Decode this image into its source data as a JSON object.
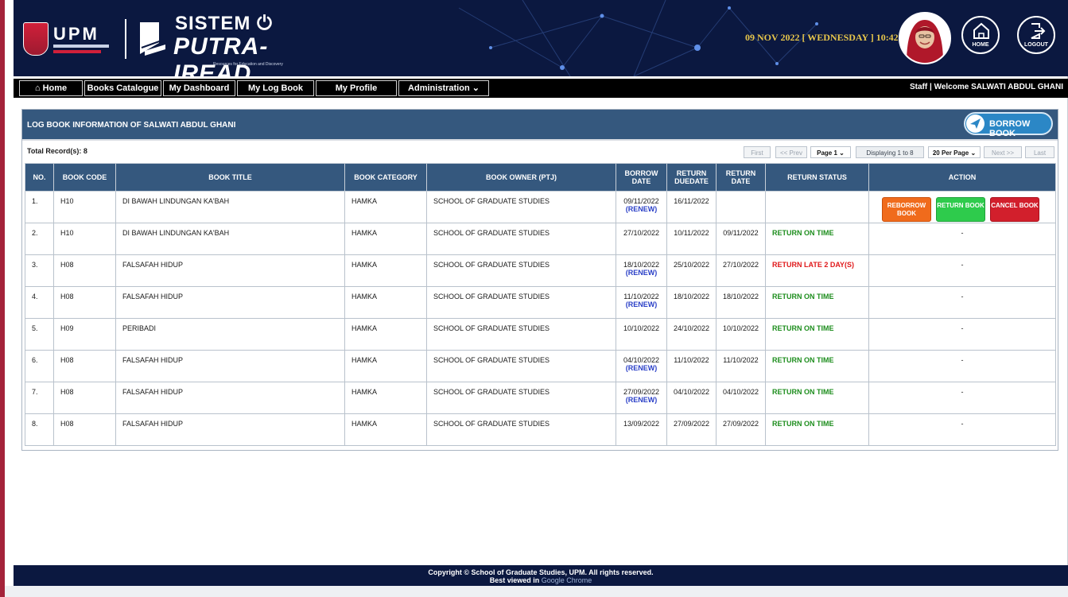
{
  "header": {
    "datetime": "09 NOV 2022 [ WEDNESDAY ] 10:42 PM",
    "home_label": "HOME",
    "logout_label": "LOGOUT"
  },
  "nav": {
    "items": [
      "Home",
      "Books Catalogue",
      "My Dashboard",
      "My Log Book",
      "My Profile",
      "Administration"
    ],
    "welcome": "Staff | Welcome SALWATI ABDUL GHANI"
  },
  "panel": {
    "title": "LOG BOOK INFORMATION OF SALWATI ABDUL GHANI",
    "borrow_button": "BORROW BOOK",
    "total": "Total Record(s): 8",
    "pager": {
      "first": "First",
      "prev": "<< Prev",
      "page": "Page 1",
      "display": "Displaying 1 to 8",
      "per_page": "20 Per Page",
      "next": "Next >>",
      "last": "Last"
    }
  },
  "table": {
    "headers": [
      "NO.",
      "BOOK CODE",
      "BOOK TITLE",
      "BOOK CATEGORY",
      "BOOK OWNER (PTJ)",
      "BORROW DATE",
      "RETURN DUEDATE",
      "RETURN DATE",
      "RETURN STATUS",
      "ACTION"
    ],
    "rows": [
      {
        "no": "1.",
        "code": "H10",
        "title": "DI BAWAH LINDUNGAN KA'BAH",
        "category": "HAMKA",
        "owner": "SCHOOL OF GRADUATE STUDIES",
        "borrow": "09/11/2022",
        "renew": "(RENEW)",
        "due": "16/11/2022",
        "returned": "",
        "status": "",
        "status_type": "none",
        "actions": true,
        "action_text": ""
      },
      {
        "no": "2.",
        "code": "H10",
        "title": "DI BAWAH LINDUNGAN KA'BAH",
        "category": "HAMKA",
        "owner": "SCHOOL OF GRADUATE STUDIES",
        "borrow": "27/10/2022",
        "renew": "",
        "due": "10/11/2022",
        "returned": "09/11/2022",
        "status": "RETURN ON TIME",
        "status_type": "ok",
        "actions": false,
        "action_text": "-"
      },
      {
        "no": "3.",
        "code": "H08",
        "title": "FALSAFAH HIDUP",
        "category": "HAMKA",
        "owner": "SCHOOL OF GRADUATE STUDIES",
        "borrow": "18/10/2022",
        "renew": "(RENEW)",
        "due": "25/10/2022",
        "returned": "27/10/2022",
        "status": "RETURN LATE 2 DAY(S)",
        "status_type": "late",
        "actions": false,
        "action_text": "-"
      },
      {
        "no": "4.",
        "code": "H08",
        "title": "FALSAFAH HIDUP",
        "category": "HAMKA",
        "owner": "SCHOOL OF GRADUATE STUDIES",
        "borrow": "11/10/2022",
        "renew": "(RENEW)",
        "due": "18/10/2022",
        "returned": "18/10/2022",
        "status": "RETURN ON TIME",
        "status_type": "ok",
        "actions": false,
        "action_text": "-"
      },
      {
        "no": "5.",
        "code": "H09",
        "title": "PERIBADI",
        "category": "HAMKA",
        "owner": "SCHOOL OF GRADUATE STUDIES",
        "borrow": "10/10/2022",
        "renew": "",
        "due": "24/10/2022",
        "returned": "10/10/2022",
        "status": "RETURN ON TIME",
        "status_type": "ok",
        "actions": false,
        "action_text": "-"
      },
      {
        "no": "6.",
        "code": "H08",
        "title": "FALSAFAH HIDUP",
        "category": "HAMKA",
        "owner": "SCHOOL OF GRADUATE STUDIES",
        "borrow": "04/10/2022",
        "renew": "(RENEW)",
        "due": "11/10/2022",
        "returned": "11/10/2022",
        "status": "RETURN ON TIME",
        "status_type": "ok",
        "actions": false,
        "action_text": "-"
      },
      {
        "no": "7.",
        "code": "H08",
        "title": "FALSAFAH HIDUP",
        "category": "HAMKA",
        "owner": "SCHOOL OF GRADUATE STUDIES",
        "borrow": "27/09/2022",
        "renew": "(RENEW)",
        "due": "04/10/2022",
        "returned": "04/10/2022",
        "status": "RETURN ON TIME",
        "status_type": "ok",
        "actions": false,
        "action_text": "-"
      },
      {
        "no": "8.",
        "code": "H08",
        "title": "FALSAFAH HIDUP",
        "category": "HAMKA",
        "owner": "SCHOOL OF GRADUATE STUDIES",
        "borrow": "13/09/2022",
        "renew": "",
        "due": "27/09/2022",
        "returned": "27/09/2022",
        "status": "RETURN ON TIME",
        "status_type": "ok",
        "actions": false,
        "action_text": "-"
      }
    ],
    "action_labels": {
      "reborrow": "REBORROW BOOK",
      "return": "RETURN BOOK",
      "cancel": "CANCEL BOOK"
    }
  },
  "footer": {
    "copyright": "Copyright © School of Graduate Studies, UPM. All rights reserved.",
    "best_viewed": "Best viewed in",
    "browser": "Google Chrome"
  },
  "colors": {
    "header_bg": "#0b1840",
    "panel_head": "#35587e",
    "status_ok": "#1e8e1e",
    "status_late": "#e0191b",
    "renew": "#2a3fc7",
    "reborrow_btn": "#f06b1c",
    "return_btn": "#2ecb4c",
    "cancel_btn": "#d21f2c",
    "date_text": "#e7c64b",
    "frame_left": "#a4233a"
  }
}
